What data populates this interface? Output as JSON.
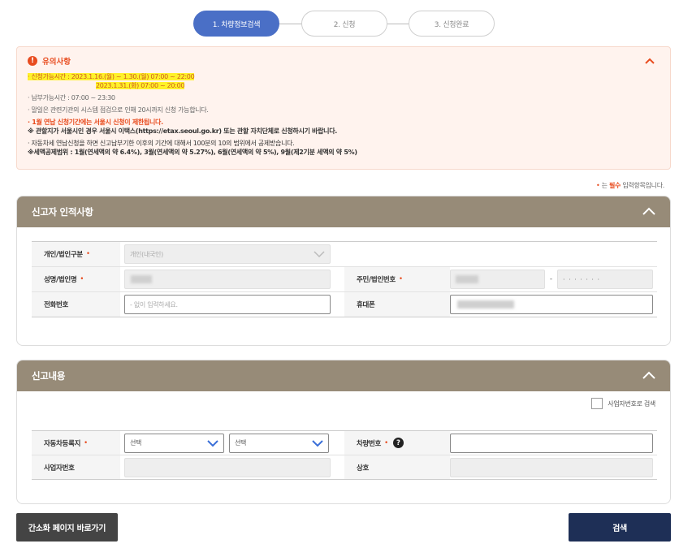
{
  "steps": [
    "1. 차량정보검색",
    "2. 신청",
    "3. 신청완료"
  ],
  "notice": {
    "title": "유의사항",
    "line1": "· 신청가능시간 : 2023.1.16.(월) ~ 1.30.(월) 07:00 ~ 22:00",
    "line2": "2023.1.31.(화) 07:00 ~ 20:00",
    "line3": "· 납부가능시간 : 07:00 ~ 23:30",
    "line4": "· 말일은 관련기관의 시스템 점검으로 인해 20시까지 신청 가능합니다.",
    "line5": "· 1월 연납 신청기간에는 서울시 신청이 제한됩니다.",
    "line6": "※ 관할지가 서울시인 경우 서울시 이택스(https://etax.seoul.go.kr) 또는 관할 자치단체로 신청하시기 바랍니다.",
    "line7": "· 자동차세 연납신청을 하면 신고납부기한 이후의 기간에 대해서 100분의 10의 범위에서 공제받습니다.",
    "line8": "※세액공제범위 : 1월(연세액의 약 6.4%), 3월(연세액의 약 5.27%), 6월(연세액의 약 5%), 9월(제2기분 세액의 약 5%)"
  },
  "required_note": {
    "dot": "•",
    "pre": " 는 ",
    "strong": "필수",
    "post": " 입력항목입니다."
  },
  "reporter": {
    "title": "신고자 인적사항",
    "type_label": "개인/법인구분",
    "type_value": "개인(내국인)",
    "name_label": "성명/법인명",
    "id_label": "주민/법인번호",
    "id_dash": "-",
    "id_masked": "· · · · · · ·",
    "phone_label": "전화번호",
    "phone_placeholder": "- 없이 입력하세요.",
    "mobile_label": "휴대폰"
  },
  "report": {
    "title": "신고내용",
    "biz_search_label": "사업자번호로 검색",
    "region_label": "자동차등록지",
    "select1": "선택",
    "select2": "선택",
    "car_no_label": "차량번호",
    "help": "?",
    "biz_no_label": "사업자번호",
    "company_label": "상호"
  },
  "required_mark": "•",
  "buttons": {
    "simple": "간소화 페이지 바로가기",
    "search": "검색"
  },
  "colors": {
    "step_active": "#4a6fc6",
    "panel_header": "#978b78",
    "accent_red": "#e84c1f",
    "highlight": "#fff12a",
    "search_button": "#1e2f56",
    "simple_button": "#444444"
  }
}
